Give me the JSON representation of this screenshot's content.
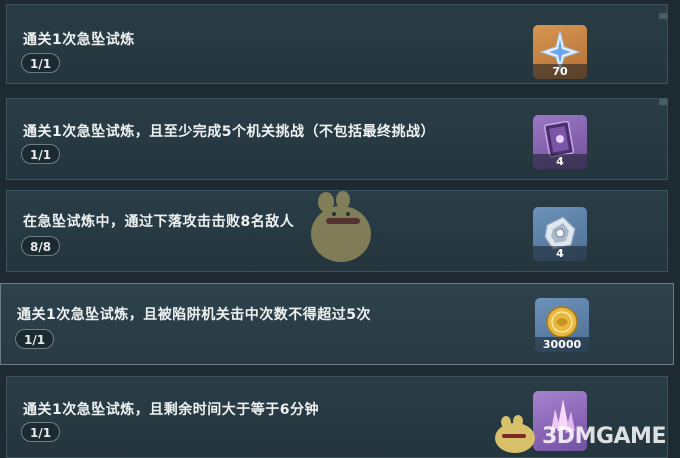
{
  "achievements": [
    {
      "title": "通关1次急坠试炼",
      "progress": "1/1",
      "reward": {
        "icon": "primogem-icon",
        "count": "70"
      }
    },
    {
      "title": "通关1次急坠试炼，且至少完成5个机关挑战（不包括最终挑战）",
      "progress": "1/1",
      "reward": {
        "icon": "heros-wit-book-icon",
        "count": "4"
      }
    },
    {
      "title": "在急坠试炼中，通过下落攻击击败8名敌人",
      "progress": "8/8",
      "reward": {
        "icon": "mystic-enhancement-ore-icon",
        "count": "4"
      }
    },
    {
      "title": "通关1次急坠试炼，且被陷阱机关击中次数不得超过5次",
      "progress": "1/1",
      "reward": {
        "icon": "mora-coin-icon",
        "count": "30000"
      }
    },
    {
      "title": "通关1次急坠试炼，且剩余时间大于等于6分钟",
      "progress": "1/1",
      "reward": {
        "icon": "crystal-chunk-icon",
        "count": ""
      }
    }
  ],
  "watermark": {
    "text": "3DMGAME"
  },
  "colors": {
    "background": "#1d2a31",
    "row_bg": "#2a3d46",
    "row_border": "#3d525c",
    "text": "#eef2f3",
    "reward_orange": "#d79651",
    "reward_purple": "#8a66b4",
    "reward_blue": "#6d92b9",
    "mora_gold": "#e8b840"
  }
}
